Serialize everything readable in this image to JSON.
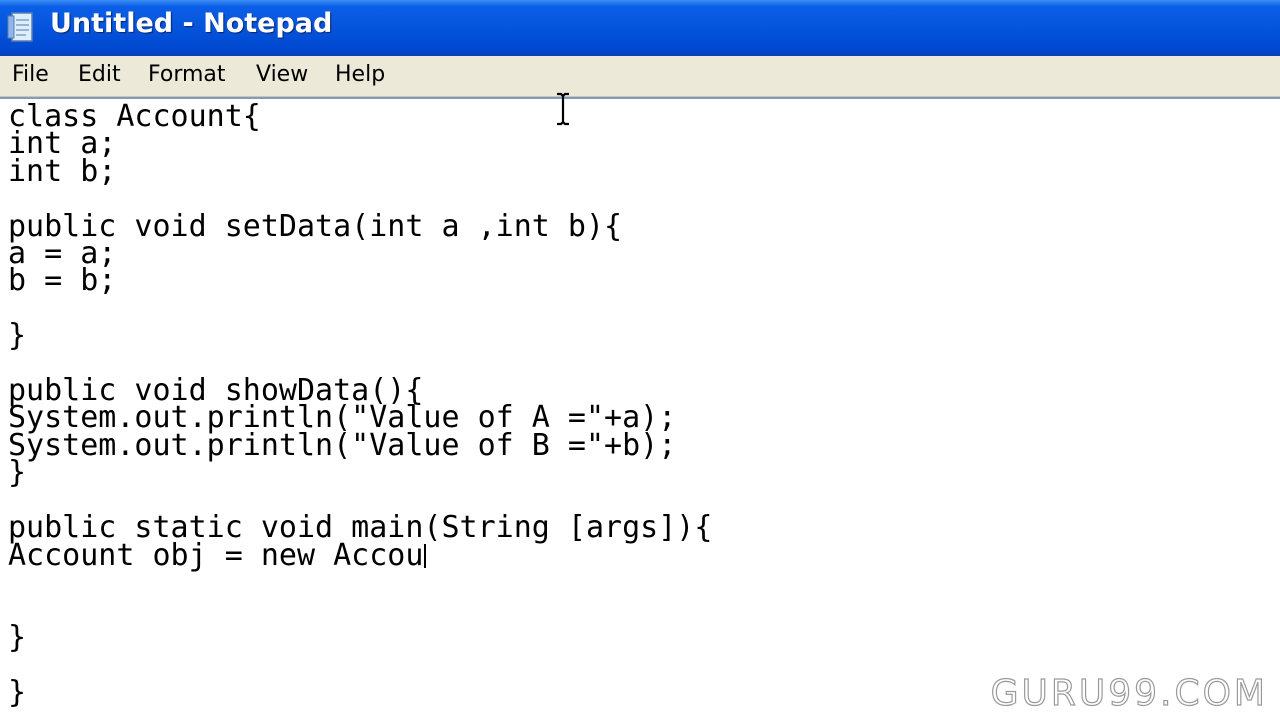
{
  "window": {
    "title": "Untitled - Notepad",
    "icon": "notepad-icon"
  },
  "menu": {
    "items": [
      "File",
      "Edit",
      "Format",
      "View",
      "Help"
    ]
  },
  "editor": {
    "lines": [
      "class Account{",
      "int a;",
      "int b;",
      "",
      "public void setData(int a ,int b){",
      "a = a;",
      "b = b;",
      "",
      "}",
      "",
      "public void showData(){",
      "System.out.println(\"Value of A =\"+a);",
      "System.out.println(\"Value of B =\"+b);",
      "}",
      "",
      "public static void main(String [args]){",
      "Account obj = new Accou",
      "",
      "",
      "}",
      "",
      "}"
    ],
    "caret_line": 16
  },
  "watermark": {
    "text": "GURU99.COM"
  },
  "colors": {
    "titlebar": "#0654dc",
    "menubar": "#ece9d8",
    "editor_bg": "#ffffff",
    "text": "#000000"
  }
}
